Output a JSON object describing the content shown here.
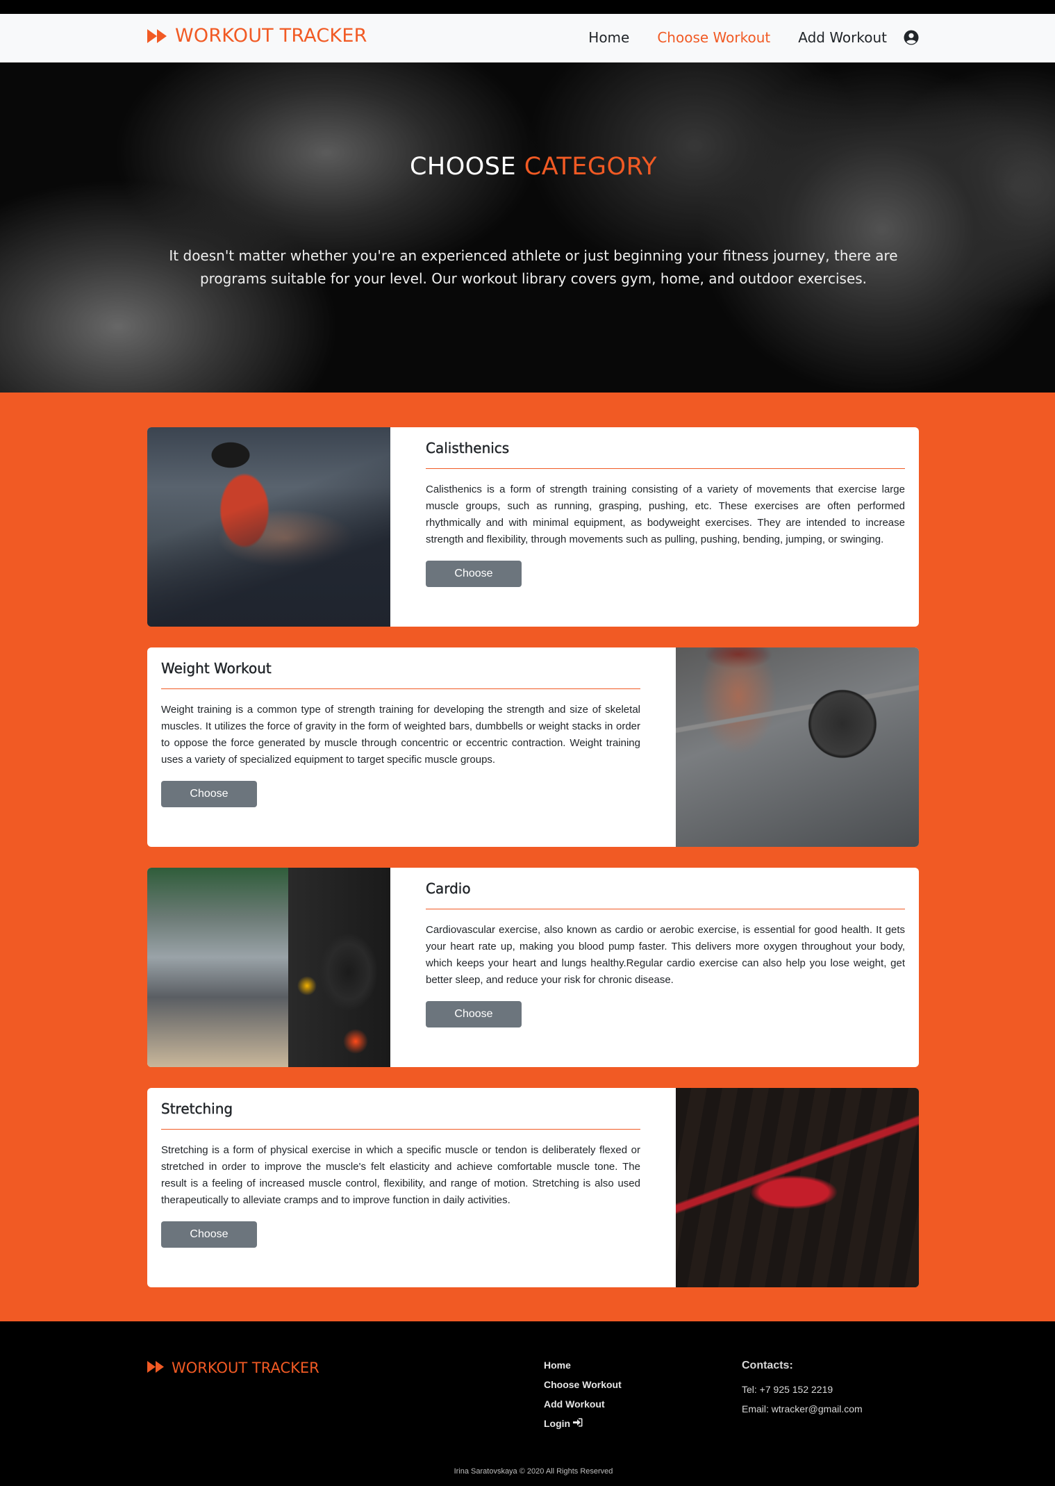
{
  "header": {
    "brand": "WORKOUT TRACKER",
    "nav": [
      {
        "label": "Home",
        "active": false
      },
      {
        "label": "Choose Workout",
        "active": true
      },
      {
        "label": "Add Workout",
        "active": false
      }
    ]
  },
  "hero": {
    "title_part1": "CHOOSE",
    "title_part2": "CATEGORY",
    "text": "It doesn't matter whether you're an experienced athlete or just beginning your fitness journey, there are programs suitable for your level. Our workout library covers gym, home, and outdoor exercises."
  },
  "categories": [
    {
      "title": "Calisthenics",
      "text": "Calisthenics is a form of strength training consisting of a variety of movements that exercise large muscle groups, such as running, grasping, pushing, etc. These exercises are often performed rhythmically and with minimal equipment, as bodyweight exercises. They are intended to increase strength and flexibility, through movements such as pulling, pushing, bending, jumping, or swinging.",
      "button": "Choose"
    },
    {
      "title": "Weight Workout",
      "text": "Weight training is a common type of strength training for developing the strength and size of skeletal muscles. It utilizes the force of gravity in the form of weighted bars, dumbbells or weight stacks in order to oppose the force generated by muscle through concentric or eccentric contraction. Weight training uses a variety of specialized equipment to target specific muscle groups.",
      "button": "Choose"
    },
    {
      "title": "Cardio",
      "text": "Cardiovascular exercise, also known as cardio or aerobic exercise, is essential for good health. It gets your heart rate up, making you blood pump faster. This delivers more oxygen throughout your body, which keeps your heart and lungs healthy.Regular cardio exercise can also help you lose weight, get better sleep, and reduce your risk for chronic disease.",
      "button": "Choose"
    },
    {
      "title": "Stretching",
      "text": "Stretching is a form of physical exercise in which a specific muscle or tendon is deliberately flexed or stretched in order to improve the muscle's felt elasticity and achieve comfortable muscle tone. The result is a feeling of increased muscle control, flexibility, and range of motion. Stretching is also used therapeutically to alleviate cramps and to improve function in daily activities.",
      "button": "Choose"
    }
  ],
  "footer": {
    "brand": "WORKOUT TRACKER",
    "links": [
      "Home",
      "Choose Workout",
      "Add Workout",
      "Login"
    ],
    "contacts_title": "Contacts:",
    "phone": "Tel: +7 925 152 2219",
    "email": "Email: wtracker@gmail.com",
    "copyright": "Irina Saratovskaya © 2020 All Rights Reserved"
  },
  "colors": {
    "accent": "#f15a24",
    "button": "#6c757d",
    "navbar_bg": "#f8f9fa"
  },
  "icons": {
    "brand": "fast-forward-icon",
    "user": "user-circle-icon",
    "login": "sign-in-icon"
  }
}
